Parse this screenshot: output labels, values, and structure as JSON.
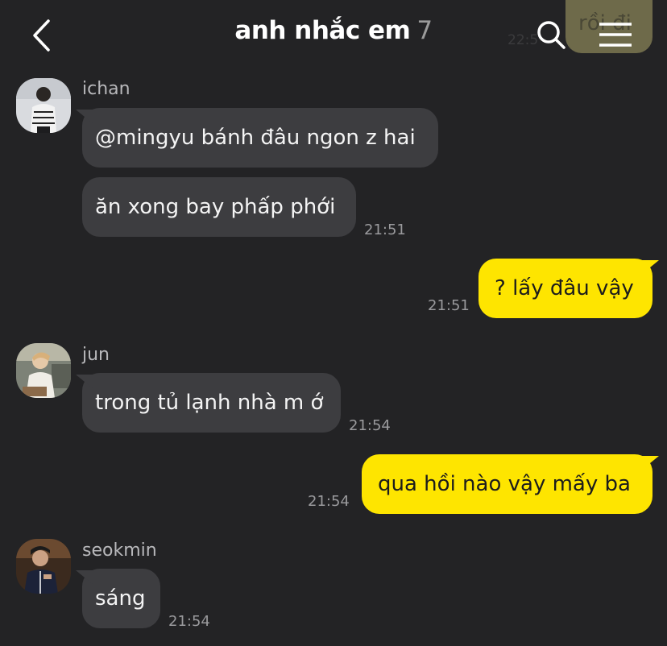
{
  "header": {
    "title": "anh nhắc em",
    "member_count": "7"
  },
  "background_message": {
    "text": "rồi đi",
    "time": "22:5"
  },
  "messages": [
    {
      "sender": "ichan",
      "lines": [
        "@mingyu bánh đâu ngon z hai",
        "ăn xong bay phấp phới"
      ],
      "time": "21:51"
    },
    {
      "mine": true,
      "text": "? lấy đâu vậy",
      "time": "21:51"
    },
    {
      "sender": "jun",
      "lines": [
        "trong tủ lạnh nhà m ớ"
      ],
      "time": "21:54"
    },
    {
      "mine": true,
      "text": "qua hồi nào vậy mấy ba",
      "time": "21:54"
    },
    {
      "sender": "seokmin",
      "lines": [
        "sáng"
      ],
      "time": "21:54"
    }
  ],
  "colors": {
    "background": "#232325",
    "incoming_bubble": "#3d3d40",
    "outgoing_bubble": "#fee500"
  },
  "icons": [
    "back-icon",
    "search-icon",
    "menu-icon",
    "avatar-ichan",
    "avatar-jun",
    "avatar-seokmin"
  ]
}
